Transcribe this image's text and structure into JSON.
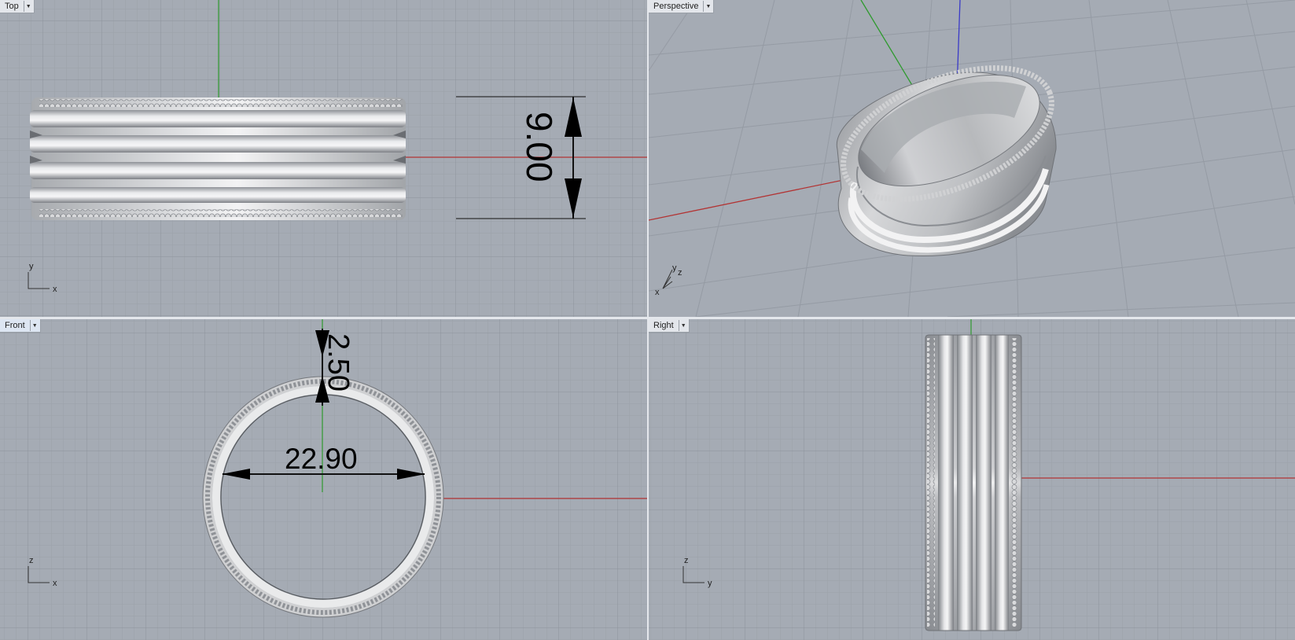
{
  "viewports": {
    "top": {
      "label": "Top"
    },
    "perspective": {
      "label": "Perspective"
    },
    "front": {
      "label": "Front"
    },
    "right": {
      "label": "Right"
    }
  },
  "dimensions": {
    "band_width": "9.00",
    "band_thickness": "2.50",
    "inner_diameter": "22.90"
  },
  "axes": {
    "top": {
      "h": "x",
      "v": "y"
    },
    "perspective": {
      "a": "x",
      "b": "y",
      "c": "z"
    },
    "front": {
      "h": "x",
      "v": "z"
    },
    "right": {
      "h": "y",
      "v": "z"
    }
  },
  "colors": {
    "viewport_bg": "#a5abb4",
    "x_axis": "#b23434",
    "y_axis": "#2e9a2e",
    "z_axis": "#3a3ac8",
    "active_tab": "#dde6f2"
  },
  "menu_icon": "dropdown-arrow-icon"
}
